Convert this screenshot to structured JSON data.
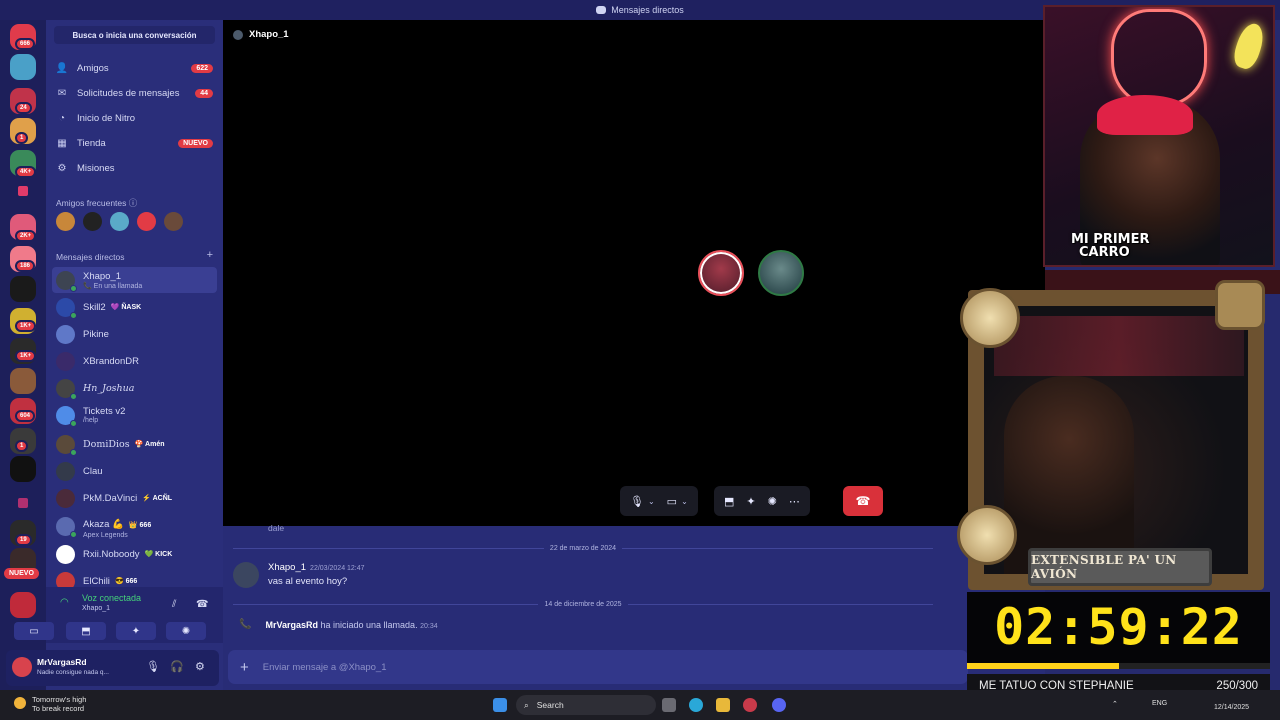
{
  "window": {
    "title": "Mensajes directos"
  },
  "rail": {
    "badges": [
      "666",
      "24",
      "1",
      "4K+",
      "2K+",
      "186",
      "1K+",
      "1K+",
      "604",
      "1",
      "19"
    ],
    "new_label": "NUEVO"
  },
  "sidebar": {
    "search": "Busca o inicia una conversación",
    "nav": [
      {
        "label": "Amigos",
        "icon": "friends-icon",
        "badge": "622"
      },
      {
        "label": "Solicitudes de mensajes",
        "icon": "mail-icon",
        "badge": "44"
      },
      {
        "label": "Inicio de Nitro",
        "icon": "nitro-icon",
        "badge": ""
      },
      {
        "label": "Tienda",
        "icon": "shop-icon",
        "badge": "NUEVO"
      },
      {
        "label": "Misiones",
        "icon": "quests-icon",
        "badge": ""
      }
    ],
    "frequent_title": "Amigos frecuentes",
    "dm_title": "Mensajes directos",
    "dms": [
      {
        "name": "Xhapo_1",
        "sub": "En una llamada",
        "tag": "",
        "color": "#3d4452"
      },
      {
        "name": "Skill2",
        "sub": "",
        "tag": "💜 ÑASK",
        "color": "#2c4aa8"
      },
      {
        "name": "Pikine",
        "sub": "",
        "tag": "",
        "color": "#5f78c8"
      },
      {
        "name": "XBrandonDR",
        "sub": "",
        "tag": "",
        "color": "#3a2a6a"
      },
      {
        "name": "Hn_Joshua",
        "sub": "",
        "tag": "",
        "color": "#444444"
      },
      {
        "name": "Tickets v2",
        "sub": "/help",
        "tag": "",
        "color": "#4f8ce8"
      },
      {
        "name": "DomiDios",
        "sub": "",
        "tag": "🍄 Amén",
        "color": "#5a4a3a"
      },
      {
        "name": "Clau",
        "sub": "",
        "tag": "",
        "color": "#333a4a"
      },
      {
        "name": "PkM.DaVinci",
        "sub": "",
        "tag": "⚡ ACÑL",
        "color": "#4a2a3a"
      },
      {
        "name": "Akaza 💪",
        "sub": "Apex Legends",
        "tag": "👑 666",
        "color": "#5a6ab0"
      },
      {
        "name": "Rxii.Noboody",
        "sub": "",
        "tag": "💚 KICK",
        "color": "#ffffff"
      },
      {
        "name": "ElChili",
        "sub": "",
        "tag": "😎 666",
        "color": "#c83a3a"
      }
    ],
    "voice": {
      "status": "Voz conectada",
      "channel": "Xhapo_1"
    },
    "user": {
      "name": "MrVargasRd",
      "status": "Nadie consigue nada q..."
    }
  },
  "call": {
    "channel_name": "Xhapo_1"
  },
  "chat": {
    "prev_message": "dale",
    "date1": "22 de marzo de 2024",
    "author": "Xhapo_1",
    "timestamp": "22/03/2024 12:47",
    "message": "vas al evento hoy?",
    "date2": "14 de diciembre de 2025",
    "sys_user": "MrVargasRd",
    "sys_text": "ha iniciado una llamada.",
    "sys_time": "20:34",
    "composer_placeholder": "Enviar mensaje a @Xhapo_1"
  },
  "stream": {
    "cam_label_1": "MI PRIMER",
    "cam_label_2": "CARRO",
    "plaque": "EXTENSIBLE PA' UN AVIÓN",
    "timer": "02:59:22",
    "goal_text": "ME TATUO CON STEPHANIE",
    "goal_count": "250/300",
    "goal_progress": 0.5
  },
  "taskbar": {
    "weather_1": "Tomorrow's high",
    "weather_2": "To break record",
    "search": "Search",
    "lang": "ENG",
    "date": "12/14/2025"
  }
}
